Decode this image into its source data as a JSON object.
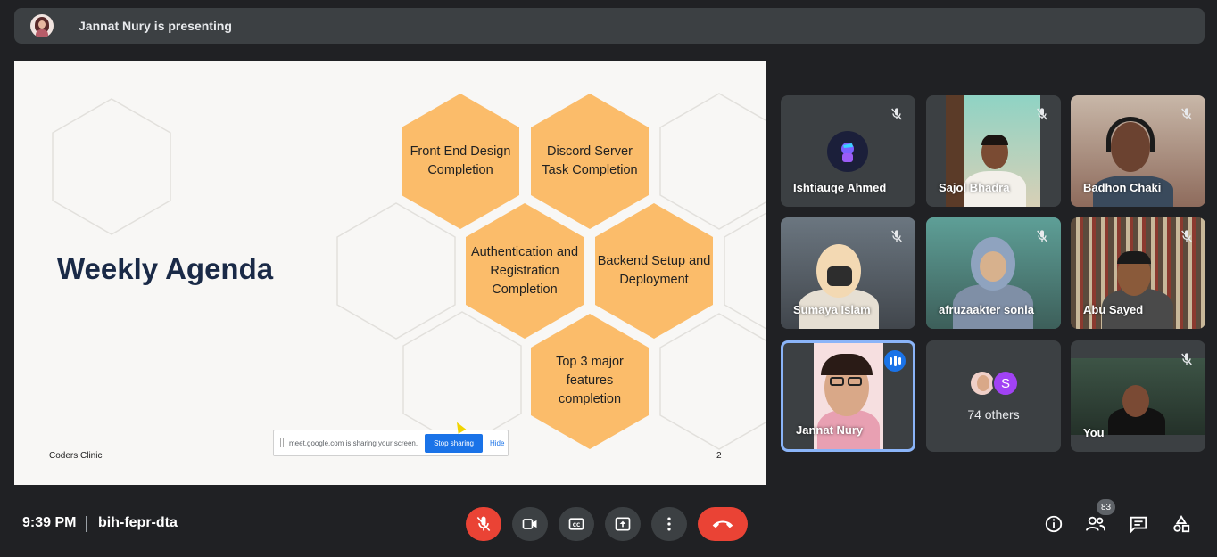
{
  "header": {
    "presenting_text": "Jannat Nury is presenting"
  },
  "slide": {
    "title": "Weekly Agenda",
    "footer": "Coders Clinic",
    "page_number": "2",
    "hexagons": [
      {
        "label": "Front End Design Completion"
      },
      {
        "label": "Discord Server Task Completion"
      },
      {
        "label": "Authentication and Registration Completion"
      },
      {
        "label": "Backend Setup and Deployment"
      },
      {
        "label": "Top 3 major features completion"
      }
    ],
    "share_bar": {
      "message": "meet.google.com is sharing your screen.",
      "stop_label": "Stop sharing",
      "hide_label": "Hide"
    }
  },
  "participants": [
    {
      "name": "Ishtiauqe Ahmed",
      "muted": true
    },
    {
      "name": "Sajol Bhadra",
      "muted": true
    },
    {
      "name": "Badhon Chaki",
      "muted": true
    },
    {
      "name": "Sumaya Islam",
      "muted": true
    },
    {
      "name": "afruzaakter sonia",
      "muted": true
    },
    {
      "name": "Abu Sayed",
      "muted": true
    },
    {
      "name": "Jannat Nury",
      "muted": false,
      "speaking": true
    },
    {
      "name": "You",
      "muted": true
    }
  ],
  "others": {
    "label": "74 others",
    "avatar_initial": "S"
  },
  "bottom_bar": {
    "time": "9:39 PM",
    "meeting_code": "bih-fepr-dta",
    "participant_count": "83"
  },
  "colors": {
    "accent_blue": "#1a73e8",
    "end_call_red": "#ea4335",
    "hex_orange": "#fbbc6a",
    "background": "#202124"
  },
  "icons": {
    "mic": "mic-off-icon",
    "camera": "videocam-icon",
    "captions": "closed-caption-icon",
    "present": "present-to-all-icon",
    "more": "more-vert-icon",
    "end": "call-end-icon",
    "info": "info-icon",
    "people": "people-icon",
    "chat": "chat-icon",
    "activities": "activities-icon"
  }
}
